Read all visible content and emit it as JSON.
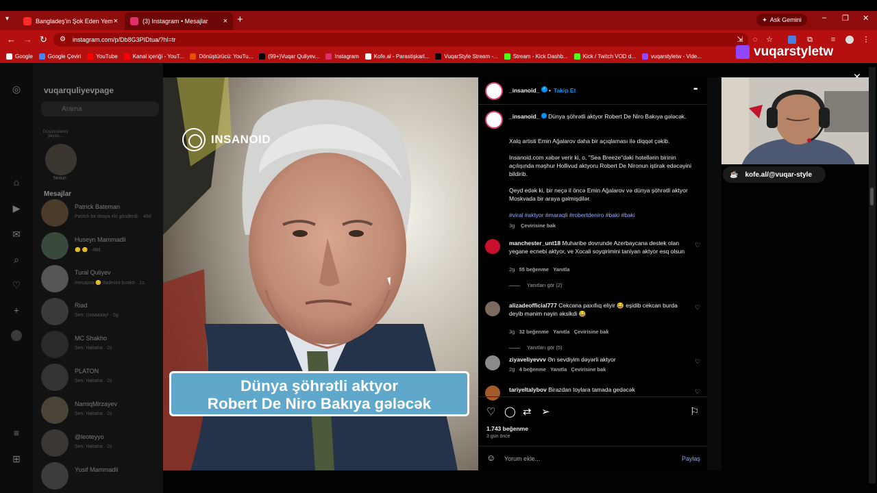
{
  "browser": {
    "tabs": [
      {
        "title": "Bangladeş'in Şok Eden Yemek F",
        "close": "×",
        "color": "#ff2a2a"
      },
      {
        "title": "(3) Instagram • Mesajlar",
        "close": "×",
        "color": "#e1306c"
      }
    ],
    "new_tab": "+",
    "gemini_label": "Ask Gemini",
    "url": "instagram.com/p/Db8G3PIDtua/?hl=tr",
    "bookmarks": [
      {
        "label": "Google",
        "color": "#ffffff"
      },
      {
        "label": "Google Çeviri",
        "color": "#4285f4"
      },
      {
        "label": "YouTube",
        "color": "#ff0000"
      },
      {
        "label": "Kanal içeriği - YouT...",
        "color": "#ff0000"
      },
      {
        "label": "Dönüştürücü: YouTu...",
        "color": "#e65100"
      },
      {
        "label": "(99+)Vuqar Quliyev...",
        "color": "#000000"
      },
      {
        "label": "Instagram",
        "color": "#e1306c"
      },
      {
        "label": "Kofe.al - Parastişkarl...",
        "color": "#ffffff"
      },
      {
        "label": "VuqarStyle Stream -...",
        "color": "#000000"
      },
      {
        "label": "Stream - Kick Dashb...",
        "color": "#53fc18"
      },
      {
        "label": "Kick / Twitch VOD d...",
        "color": "#53fc18"
      },
      {
        "label": "vuqarstyletw - Vide...",
        "color": "#9146ff"
      }
    ]
  },
  "instagram": {
    "account": "vuqarquliyevpage",
    "search_placeholder": "Arama",
    "note_label": "Notun",
    "note_bubble": "Düşüncelerini paylaş...",
    "messages_heading": "Mesajlar",
    "conversations": [
      {
        "name": "Patrick Bateman",
        "preview": "Patrick bir dosya eki gönderdi. · 46d"
      },
      {
        "name": "Huseyn Mammadli",
        "preview": "😊 😊 · 48d"
      },
      {
        "name": "Tural Quliyev",
        "preview": "mesajına 😊 ifadesini bıraktı · 1s"
      },
      {
        "name": "Riad",
        "preview": "Sen: Uxaaaaay! · 5g"
      },
      {
        "name": "MC Shakho",
        "preview": "Sen: Hahaha · 2s"
      },
      {
        "name": "PLATON",
        "preview": "Sen: Hahaha · 2s"
      },
      {
        "name": "NamiqMirzayev",
        "preview": "Sen: Hahaha · 2s"
      },
      {
        "name": "@leoteyyo",
        "preview": "Sen: Hahaha · 2s"
      },
      {
        "name": "Yusif Mammadli",
        "preview": ""
      }
    ]
  },
  "post": {
    "image_logo": "INSANOID",
    "banner_line1": "Dünya şöhrətli aktyor",
    "banner_line2": "Robert De Niro Bakıya gələcək",
    "author": "_insanoid_",
    "follow_label": "Takip Et",
    "more": "•••",
    "caption_lead": "Dünya şöhrətli aktyor Robert De Niro Bakıya gələcək.",
    "paragraphs": [
      "Xalq artisti Emin Ağalarov daha bir açıqlaması ilə diqqət çəkib.",
      "Insanoid.com xəbər verir ki, o, \"Sea Breeze\"dəki hotellərin birinin açılışında məşhur Hollivud aktyoru Robert De Nironun iştirak edəcəyini bildirib.",
      "Qeyd edək ki, bir neçə il öncə Emin Ağalarov və dünya şöhrətli aktyor Moskvada bir araya gəlmişdilər."
    ],
    "hashtags": "#viral #aktyor #maraqli #robertdeniro #baki #baki",
    "caption_age": "3g",
    "see_translation": "Çevirisine bak",
    "comments": [
      {
        "user": "manchester_unt18",
        "text": "Muharibe dovrunde Azerbaycana destek olan yegane ecnebi aktyor, ve Xocali soyqirimini taniyan aktyor esq olsun",
        "age": "2g",
        "likes": "55 beğenme",
        "reply": "Yanıtla",
        "translate": "",
        "replies": "Yanıtları gör (2)",
        "avatar_color": "#c8102e"
      },
      {
        "user": "alizadeofficial777",
        "text": "Cekcana paxıllıq eliyir 😂 eşidib cekcan burda deyib mənim nəyin əksikdi 😂",
        "age": "3g",
        "likes": "32 beğenme",
        "reply": "Yanıtla",
        "translate": "Çevirisine bak",
        "replies": "Yanıtları gör (5)",
        "avatar_color": "#7a6a60"
      },
      {
        "user": "ziyaveliyevvv",
        "text": "Ən sevdiyim dəyərli aktyor",
        "age": "2g",
        "likes": "4 beğenme",
        "reply": "Yanıtla",
        "translate": "Çevirisine bak",
        "replies": "",
        "avatar_color": "#8a8a8a"
      },
      {
        "user": "tariyeltalybov",
        "text": "Birazdan toylara tamada gedəcək",
        "age": "",
        "likes": "",
        "reply": "",
        "translate": "",
        "replies": "",
        "avatar_color": "#a35a2a"
      }
    ],
    "likes_total": "1.743 beğenme",
    "posted_ago": "3 gün önce",
    "comment_placeholder": "Yorum ekle...",
    "share_label": "Paylaş"
  },
  "stream_overlay": {
    "twitch_handle": "vuqarstyletw",
    "kofe_label": "kofe.al/@vuqar-style"
  },
  "colors": {
    "browser_frame": "#b50f0f",
    "tab_strip": "#8f0c0c",
    "ig_verified": "#0095f6",
    "hashtag": "#96aaff",
    "banner": "#5fa8cc"
  }
}
